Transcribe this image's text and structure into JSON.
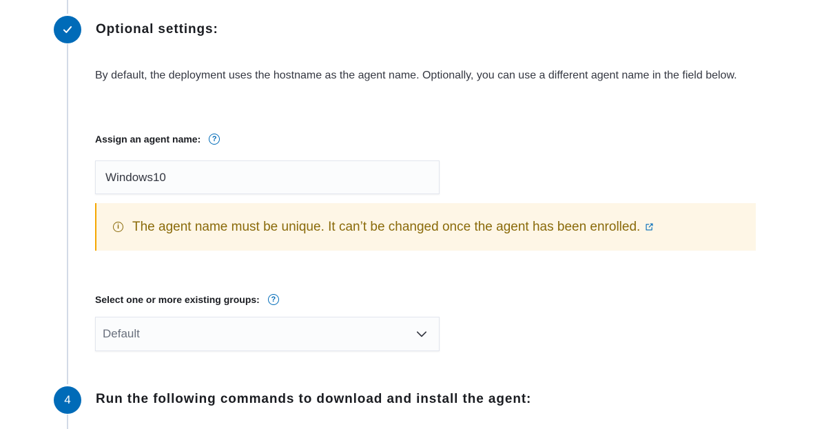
{
  "step3": {
    "title": "Optional settings:",
    "description": "By default, the deployment uses the hostname as the agent name. Optionally, you can use a different agent name in the field below.",
    "agent_name_label": "Assign an agent name:",
    "agent_name_value": "Windows10",
    "callout_text": "The agent name must be unique. It can’t be changed once the agent has been enrolled.",
    "groups_label": "Select one or more existing groups:",
    "groups_selected": "Default"
  },
  "step4": {
    "number": "4",
    "title": "Run the following commands to download and install the agent:"
  },
  "colors": {
    "accent": "#006bb8",
    "warning_bg": "#fef6e6",
    "warning_text": "#8a6a0a",
    "warning_border": "#f5a700"
  },
  "icons": {
    "step3_status": "check-icon",
    "help": "question-circle-icon",
    "callout": "info-icon",
    "external_link": "external-link-icon",
    "select_arrow": "chevron-down-icon"
  }
}
